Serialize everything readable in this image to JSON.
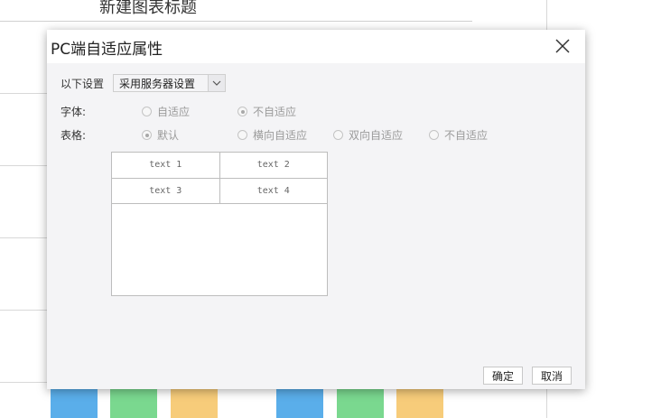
{
  "background": {
    "title": "新建图表标题",
    "swatch_colors": [
      "#5aaeea",
      "#7ad88f",
      "#f7cc7a",
      "#5aaeea",
      "#7ad88f",
      "#f7cc7a"
    ]
  },
  "dialog": {
    "title": "PC端自适应属性",
    "close_icon": "close-icon",
    "settings_label": "以下设置",
    "settings_select": {
      "value": "采用服务器设置",
      "arrow_icon": "chevron-down-icon"
    },
    "font_row": {
      "label": "字体:",
      "options": [
        {
          "label": "自适应",
          "checked": false
        },
        {
          "label": "不自适应",
          "checked": true
        }
      ]
    },
    "table_row": {
      "label": "表格:",
      "options": [
        {
          "label": "默认",
          "checked": true
        },
        {
          "label": "横向自适应",
          "checked": false
        },
        {
          "label": "双向自适应",
          "checked": false
        },
        {
          "label": "不自适应",
          "checked": false
        }
      ]
    },
    "preview_cells": [
      [
        "text 1",
        "text 2"
      ],
      [
        "text 3",
        "text 4"
      ]
    ],
    "buttons": {
      "ok": "确定",
      "cancel": "取消"
    }
  }
}
